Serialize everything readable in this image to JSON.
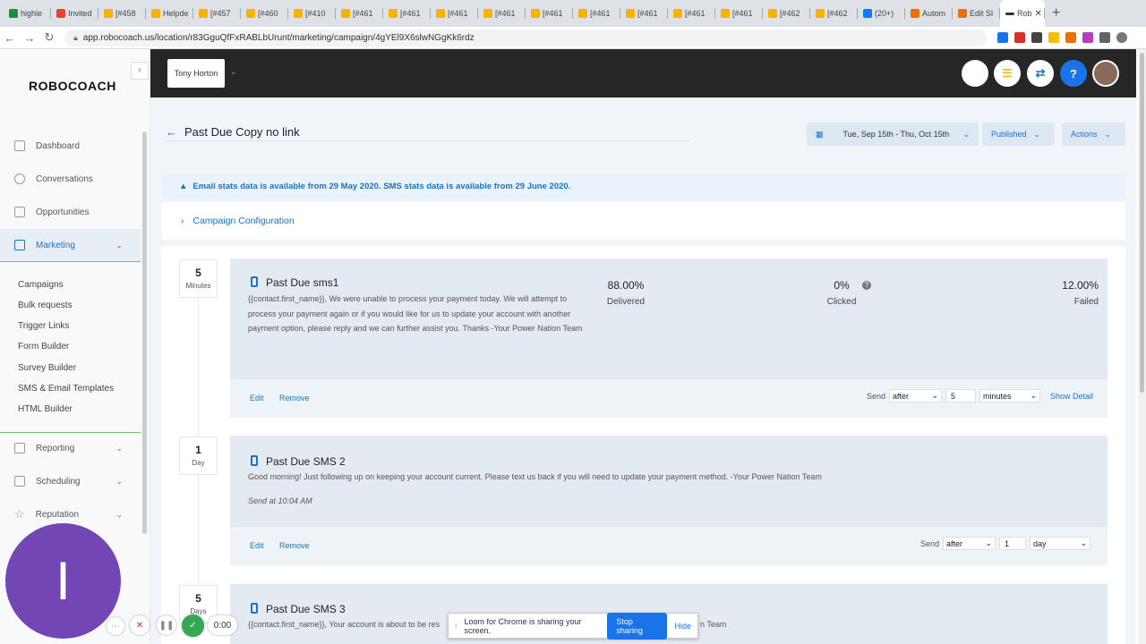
{
  "browser": {
    "tabs": [
      {
        "label": "highle",
        "color": "#1e8e3e"
      },
      {
        "label": "Invited",
        "color": "#ea4335"
      },
      {
        "label": "[#458",
        "color": "#f4b400"
      },
      {
        "label": "Helpde",
        "color": "#f4b400"
      },
      {
        "label": "[#457",
        "color": "#f4b400"
      },
      {
        "label": "[#460",
        "color": "#f4b400"
      },
      {
        "label": "[#410",
        "color": "#f4b400"
      },
      {
        "label": "[#461",
        "color": "#f4b400"
      },
      {
        "label": "[#461",
        "color": "#f4b400"
      },
      {
        "label": "[#461",
        "color": "#f4b400"
      },
      {
        "label": "[#461",
        "color": "#f4b400"
      },
      {
        "label": "[#461",
        "color": "#f4b400"
      },
      {
        "label": "[#461",
        "color": "#f4b400"
      },
      {
        "label": "[#461",
        "color": "#f4b400"
      },
      {
        "label": "[#461",
        "color": "#f4b400"
      },
      {
        "label": "[#461",
        "color": "#f4b400"
      },
      {
        "label": "[#462",
        "color": "#f4b400"
      },
      {
        "label": "[#462",
        "color": "#f4b400"
      },
      {
        "label": "(20+)",
        "color": "#1877f2"
      },
      {
        "label": "Autom",
        "color": "#e8710a"
      },
      {
        "label": "Edit Sl",
        "color": "#e8710a"
      }
    ],
    "active_tab": "Rob",
    "url": "app.robocoach.us/location/r83GguQfFxRABLbUrunt/marketing/campaign/4gYEl9X6slwNGgKk6rdz"
  },
  "sidebar": {
    "logo": "ROBOCOACH",
    "items": [
      {
        "label": "Dashboard"
      },
      {
        "label": "Conversations"
      },
      {
        "label": "Opportunities"
      },
      {
        "label": "Marketing"
      }
    ],
    "subitems": [
      "Campaigns",
      "Bulk requests",
      "Trigger Links",
      "Form Builder",
      "Survey Builder",
      "SMS & Email Templates",
      "HTML Builder"
    ],
    "lower_items": [
      {
        "label": "Reporting"
      },
      {
        "label": "Scheduling"
      },
      {
        "label": "Reputation"
      }
    ]
  },
  "topbar": {
    "location": "Tony Horton",
    "help": "?"
  },
  "page": {
    "title": "Past Due Copy no link",
    "date_range": "Tue, Sep 15th - Thu, Oct 15th",
    "status": "Published",
    "actions": "Actions",
    "banner": "Email stats data is available from 29 May 2020. SMS stats data is available from 29 June 2020.",
    "config": "Campaign Configuration"
  },
  "steps": [
    {
      "delay_value": "5",
      "delay_unit": "Minutes",
      "name": "Past Due sms1",
      "message": "{{contact.first_name}}, We were unable to process your payment today. We will attempt to process your payment again or if you would like for us to update your account with another payment option, please reply and we can further assist you. Thanks -Your Power Nation Team",
      "stats": [
        {
          "value": "88.00%",
          "label": "Delivered"
        },
        {
          "value": "0%",
          "label": "Clicked"
        },
        {
          "value": "12.00%",
          "label": "Failed"
        }
      ],
      "edit": "Edit",
      "remove": "Remove",
      "send_label": "Send",
      "send_when": "after",
      "send_amount": "5",
      "send_unit": "minutes",
      "show_detail": "Show Detail"
    },
    {
      "delay_value": "1",
      "delay_unit": "Day",
      "name": "Past Due SMS 2",
      "message": "Good morning! Just following up on keeping your account current. Please text us back if you will need to update your payment method.  -Your Power Nation Team",
      "send_at": "Send at 10:04 AM",
      "edit": "Edit",
      "remove": "Remove",
      "send_label": "Send",
      "send_when": "after",
      "send_amount": "1",
      "send_unit": "day"
    },
    {
      "delay_value": "5",
      "delay_unit": "Days",
      "name": "Past Due SMS 3",
      "message_start": "{{contact.first_name}}, Your account is about to be res",
      "message_end": "n Team"
    }
  ],
  "recorder": {
    "avatar_letter": "I",
    "timer": "0:00"
  },
  "loom": {
    "text": "Loom for Chrome is sharing your screen.",
    "stop": "Stop sharing",
    "hide": "Hide"
  }
}
